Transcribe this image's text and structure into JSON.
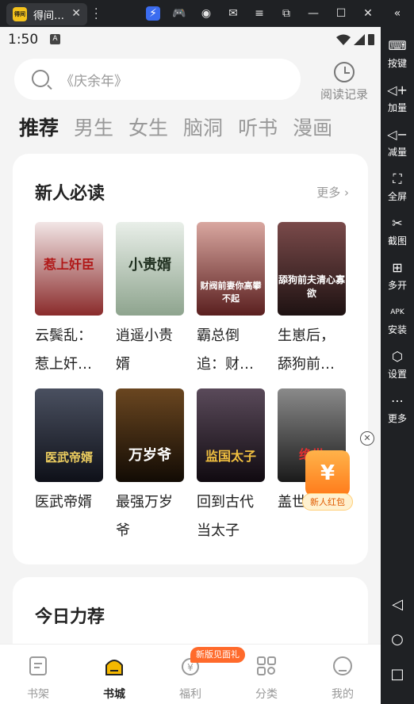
{
  "emulator": {
    "tab_title": "得间…",
    "app_icon_text": "得间",
    "tab_close": "✕",
    "top_icons": [
      "bolt-icon",
      "gamepad-icon",
      "user-icon",
      "mail-icon",
      "menu-icon",
      "screen-icon",
      "minimize-icon",
      "maximize-icon",
      "close-icon",
      "collapse-icon"
    ],
    "side_panel": [
      {
        "label": "按键",
        "icon": "keyboard-icon",
        "glyph": "⌨"
      },
      {
        "label": "加量",
        "icon": "volume-up-icon",
        "glyph": "🔊"
      },
      {
        "label": "减量",
        "icon": "volume-down-icon",
        "glyph": "🔉"
      },
      {
        "label": "全屏",
        "icon": "fullscreen-icon",
        "glyph": "⛶"
      },
      {
        "label": "截图",
        "icon": "scissors-icon",
        "glyph": "✂"
      },
      {
        "label": "多开",
        "icon": "multi-instance-icon",
        "glyph": "⊞"
      },
      {
        "label": "安装",
        "icon": "apk-install-icon",
        "glyph": "APK"
      },
      {
        "label": "设置",
        "icon": "settings-icon",
        "glyph": "⬡"
      },
      {
        "label": "更多",
        "icon": "more-icon",
        "glyph": "⋯"
      }
    ]
  },
  "status_bar": {
    "time": "1:50",
    "a_icon": "A"
  },
  "search": {
    "placeholder": "《庆余年》"
  },
  "history": {
    "label": "阅读记录"
  },
  "tabs": [
    "推荐",
    "男生",
    "女生",
    "脑洞",
    "听书",
    "漫画"
  ],
  "section1": {
    "title": "新人必读",
    "more": "更多 ›",
    "books": [
      {
        "title": "云鬓乱：惹上奸…",
        "cover_text": "惹上奸臣",
        "colors": [
          "#f2e6e6",
          "#8a2b2b"
        ]
      },
      {
        "title": "逍遥小贵婿",
        "cover_text": "小贵婿",
        "colors": [
          "#e9efe9",
          "#4a5a4a"
        ]
      },
      {
        "title": "霸总倒追：财…",
        "cover_text": "财阀前妻你高攀不起",
        "colors": [
          "#d9a7a0",
          "#5a1f1f"
        ]
      },
      {
        "title": "生崽后，舔狗前…",
        "cover_text": "舔狗前夫清心寡欲",
        "colors": [
          "#4a2a2a",
          "#1e1212"
        ]
      },
      {
        "title": "医武帝婿",
        "cover_text": "医武帝婿",
        "colors": [
          "#2a3040",
          "#0e1018"
        ]
      },
      {
        "title": "最强万岁爷",
        "cover_text": "万岁爷",
        "colors": [
          "#3a2610",
          "#120b04"
        ]
      },
      {
        "title": "回到古代当太子",
        "cover_text": "监国太子",
        "colors": [
          "#3a2a3a",
          "#100a10"
        ]
      },
      {
        "title": "盖世…",
        "cover_text": "绝世",
        "colors": [
          "#6a6a6a",
          "#1a1a1a"
        ]
      }
    ]
  },
  "section2": {
    "title": "今日力荐"
  },
  "float": {
    "close": "✕",
    "redpack_label": "新人红包",
    "redpack_symbol": "¥"
  },
  "bottom_nav": {
    "badge": "新版见面礼",
    "items": [
      "书架",
      "书城",
      "福利",
      "分类",
      "我的"
    ]
  }
}
